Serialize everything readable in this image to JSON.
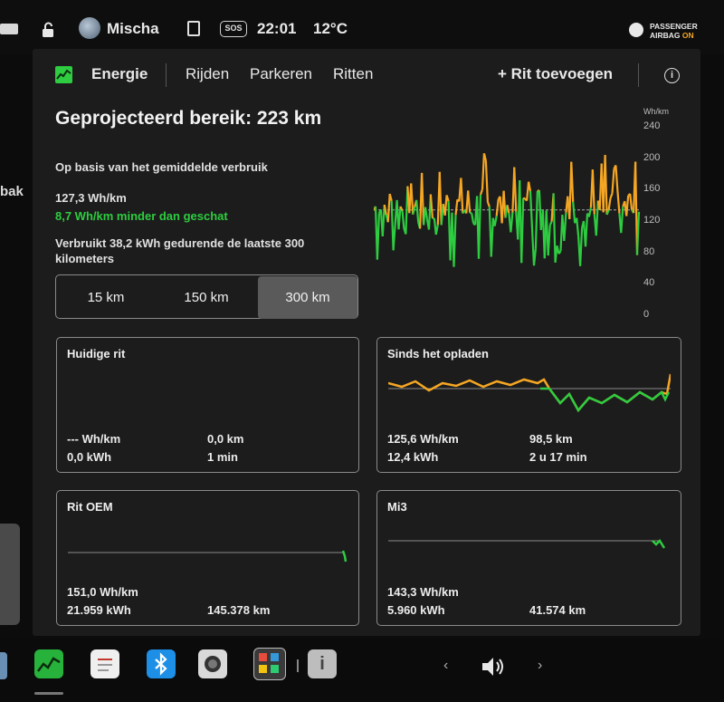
{
  "status_bar": {
    "profile_name": "Mischa",
    "time": "22:01",
    "temperature": "12°C",
    "sos_label": "SOS",
    "airbag_line1": "PASSENGER",
    "airbag_line2": "AIRBAG",
    "airbag_state": "ON",
    "left_edge_text": "bak"
  },
  "tabs": [
    "Energie",
    "Rijden",
    "Parkeren",
    "Ritten"
  ],
  "actions": {
    "add_trip": "+ Rit toevoegen",
    "info": "i"
  },
  "summary": {
    "title": "Geprojecteerd bereik: 223 km",
    "subtitle": "Op basis van het gemiddelde verbruik",
    "avg_consumption": "127,3 Wh/km",
    "delta": "8,7 Wh/km minder dan geschat",
    "used": "Verbruikt 38,2 kWh gedurende de laatste 300 kilometers"
  },
  "range_selector": {
    "options": [
      "15 km",
      "150 km",
      "300 km"
    ],
    "selected": "300 km"
  },
  "graph": {
    "unit": "Wh/km",
    "y_ticks": [
      "240",
      "200",
      "160",
      "120",
      "80",
      "40",
      "0"
    ],
    "ylim": [
      0,
      240
    ],
    "avg": 127
  },
  "cards": {
    "current_trip": {
      "title": "Huidige rit",
      "consumption": "--- Wh/km",
      "distance": "0,0 km",
      "energy": "0,0 kWh",
      "duration": "1 min"
    },
    "since_charge": {
      "title": "Sinds het opladen",
      "consumption": "125,6 Wh/km",
      "distance": "98,5 km",
      "energy": "12,4 kWh",
      "duration": "2 u 17 min"
    },
    "trip_oem": {
      "title": "Rit OEM",
      "consumption": "151,0 Wh/km",
      "energy": "21.959 kWh",
      "distance": "145.378 km"
    },
    "mi3": {
      "title": "Mi3",
      "consumption": "143,3 Wh/km",
      "energy": "5.960 kWh",
      "distance": "41.574 km"
    }
  },
  "colors": {
    "above": "#f5a623",
    "below": "#2ecc40",
    "panel": "#1c1c1c",
    "selected_segment": "#5a5a5a"
  },
  "dock": {
    "icons": [
      "energy-app-icon",
      "notes-app-icon",
      "bluetooth-icon",
      "camera-icon",
      "apps-grid-icon",
      "info-icon"
    ],
    "volume": "volume-icon"
  }
}
